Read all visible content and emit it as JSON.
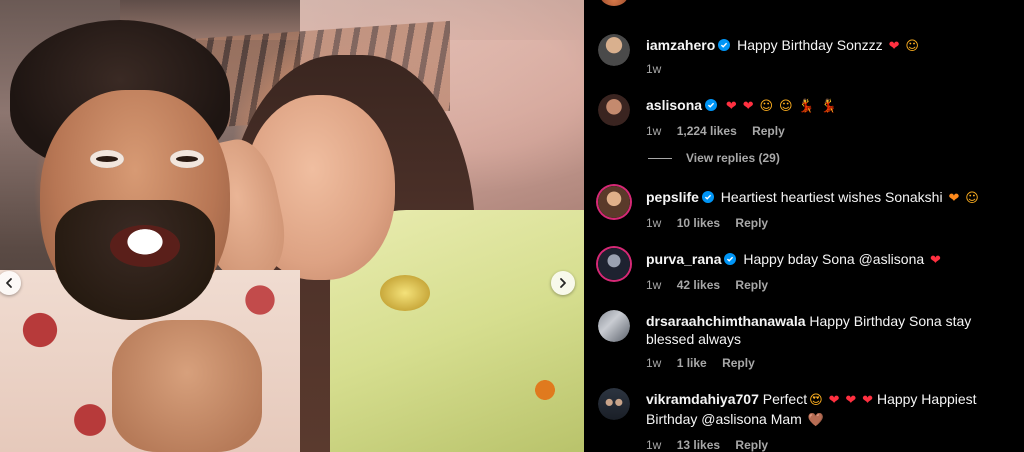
{
  "post": {
    "nav_prev_icon": "chevron-left-icon",
    "nav_next_icon": "chevron-right-icon"
  },
  "comments": [
    {
      "username": "iamzahero",
      "verified": true,
      "text": "Happy Birthday Sonzzz",
      "emojis": [
        "❤",
        "☺"
      ],
      "time": "1w",
      "likes": "",
      "reply": ""
    },
    {
      "username": "aslisona",
      "verified": true,
      "text": "",
      "emojis": [
        "❤",
        "❤",
        "☺",
        "☺",
        "💃",
        "💃"
      ],
      "time": "1w",
      "likes": "1,224 likes",
      "reply": "Reply"
    },
    {
      "username": "pepslife",
      "verified": true,
      "text": "Heartiest heartiest wishes Sonakshi",
      "emojis": [
        "❤",
        "☺"
      ],
      "time": "1w",
      "likes": "10 likes",
      "reply": "Reply"
    },
    {
      "username": "purva_rana",
      "verified": true,
      "text": "Happy bday Sona @aslisona",
      "emojis": [
        "❤"
      ],
      "time": "1w",
      "likes": "42 likes",
      "reply": "Reply"
    },
    {
      "username": "drsaraahchimthanawala",
      "verified": false,
      "text": "Happy Birthday Sona stay blessed always",
      "emojis": [],
      "time": "1w",
      "likes": "1 like",
      "reply": "Reply"
    },
    {
      "username": "vikramdahiya707",
      "verified": false,
      "text_before": "Perfect",
      "text": "Happy Happiest Birthday @aslisona Mam",
      "emojis": [
        "😍",
        "❤",
        "❤",
        "❤"
      ],
      "trailing_emoji": "🤎",
      "time": "1w",
      "likes": "13 likes",
      "reply": "Reply"
    }
  ],
  "view_replies": "View replies (29)",
  "colors": {
    "background": "#000000",
    "text": "#f5f5f5",
    "meta": "#a8a8a8",
    "verified": "#0095f6",
    "heart": "#ff3040"
  }
}
